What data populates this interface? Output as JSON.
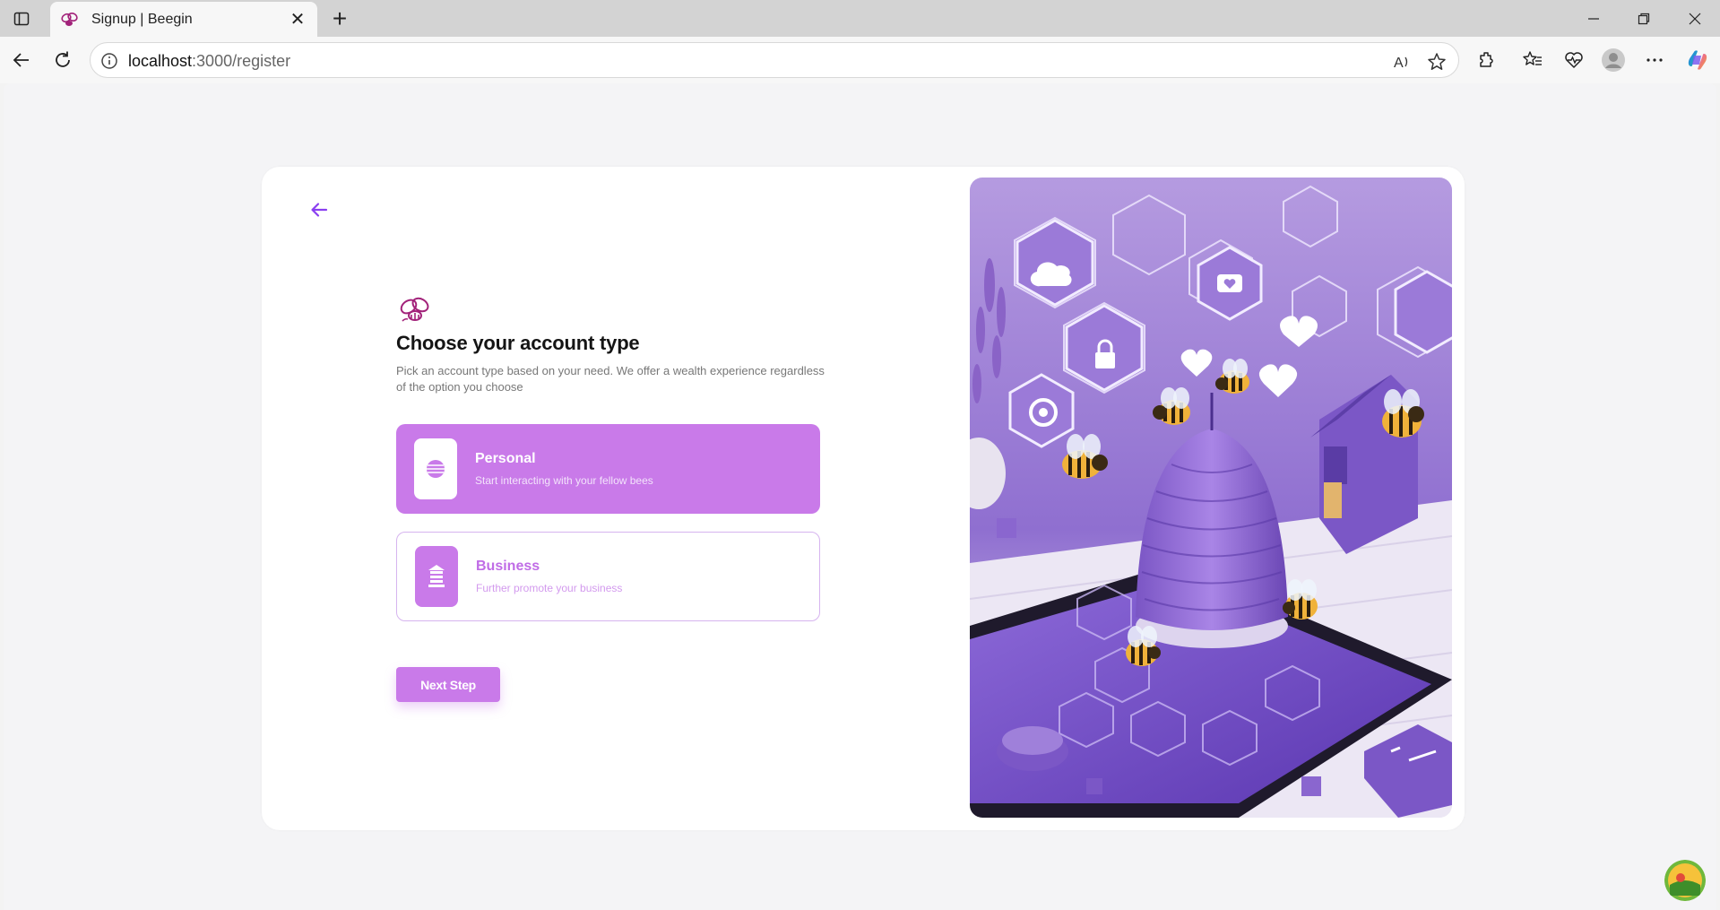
{
  "browser": {
    "tab_title": "Signup | Beegin",
    "url_host": "localhost",
    "url_path": ":3000/register",
    "read_aloud_label": "A",
    "more_label": "···"
  },
  "page": {
    "title": "Choose your account type",
    "subtitle": "Pick an account type based on your need. We offer a wealth experience regardless of the option you choose",
    "options": [
      {
        "label": "Personal",
        "description": "Start interacting with your fellow bees",
        "selected": true
      },
      {
        "label": "Business",
        "description": "Further promote your business",
        "selected": false
      }
    ],
    "next_button": "Next Step"
  },
  "colors": {
    "accent": "#c97ae9",
    "back_arrow": "#8a3ff0"
  }
}
